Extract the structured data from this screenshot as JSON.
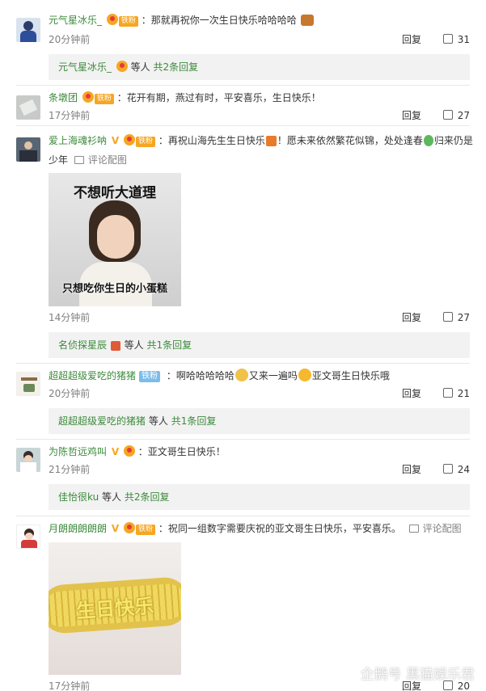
{
  "comments": [
    {
      "user": "元气星冰乐_",
      "badge": "铁粉",
      "text": "：那就再祝你一次生日快乐哈哈哈哈",
      "time": "20分钟前",
      "reply": "回复",
      "likes": "31",
      "sub": {
        "name": "元气星冰乐_",
        "etc": "等人",
        "count": "共2条回复"
      }
    },
    {
      "user": "条墩团",
      "badge": "铁粉",
      "text": "：花开有期，燕过有时，平安喜乐，生日快乐！",
      "time": "17分钟前",
      "reply": "回复",
      "likes": "27"
    },
    {
      "user": "爱上海魂衫呐",
      "badge": "铁粉",
      "text_a": "：再祝山海先生生日快乐",
      "text_b": "！愿未来依然繁花似锦，处处逢春",
      "text_c": "归来仍是",
      "text_wrap": "少年",
      "pic_link": "评论配图",
      "img_top": "不想听大道理",
      "img_bottom": "只想吃你生日的小蛋糕",
      "time": "14分钟前",
      "reply": "回复",
      "likes": "27",
      "sub": {
        "name": "名侦探星辰",
        "etc": "等人",
        "count": "共1条回复"
      }
    },
    {
      "user": "超超超级爱吃的猪猪",
      "badge": "铁粉",
      "text_a": "：啊哈哈哈哈哈",
      "text_b": "又来一遍吗",
      "text_c": "亚文哥生日快乐哦",
      "time": "20分钟前",
      "reply": "回复",
      "likes": "21",
      "sub": {
        "name": "超超超级爱吃的猪猪",
        "etc": "等人",
        "count": "共1条回复"
      }
    },
    {
      "user": "为陈哲远鸡叫",
      "text": "：亚文哥生日快乐！",
      "time": "21分钟前",
      "reply": "回复",
      "likes": "24",
      "sub": {
        "name": "佳怡很ku",
        "etc": "等人",
        "count": "共2条回复"
      }
    },
    {
      "user": "月朗朗朗朗朗",
      "badge": "铁粉",
      "text": "：祝同一组数字需要庆祝的亚文哥生日快乐，平安喜乐。",
      "pic_link": "评论配图",
      "img_text": "生日快乐",
      "time": "17分钟前",
      "reply": "回复",
      "likes": "20"
    }
  ],
  "watermark": "企鹅号 黑猫娱乐君",
  "colors": {
    "username": "#3c8a3c",
    "subbox_bg": "#f2f2f2",
    "badge": "#f6a623",
    "ironfan": "#7dbce8"
  }
}
